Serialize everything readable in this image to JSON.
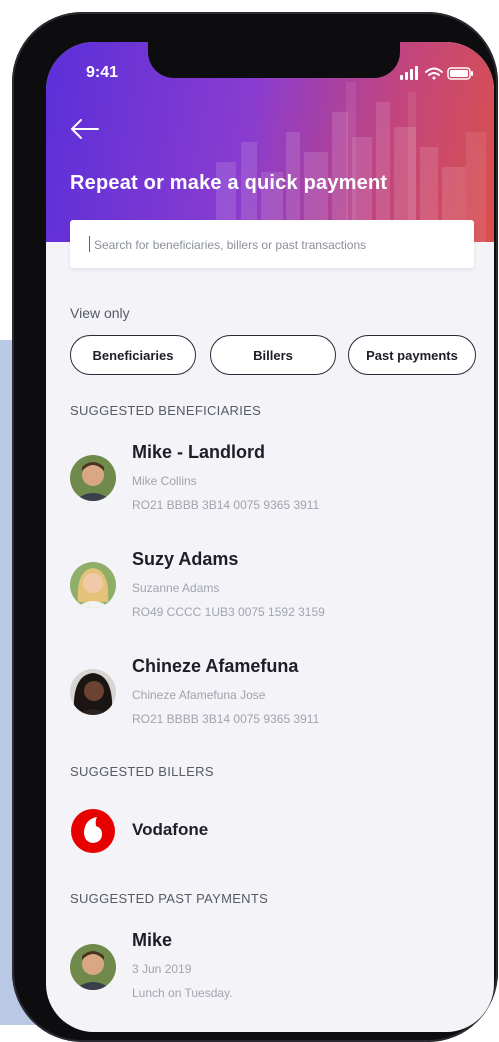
{
  "status_bar": {
    "time": "9:41"
  },
  "header": {
    "title": "Repeat or make a quick payment"
  },
  "search": {
    "placeholder": "Search for beneficiaries, billers or past transactions"
  },
  "filters": {
    "label": "View only",
    "chips": [
      "Beneficiaries",
      "Billers",
      "Past payments"
    ]
  },
  "sections": {
    "beneficiaries": "SUGGESTED BENEFICIARIES",
    "billers": "SUGGESTED BILLERS",
    "past_payments": "SUGGESTED PAST PAYMENTS"
  },
  "beneficiaries": [
    {
      "name": "Mike - Landlord",
      "full_name": "Mike Collins",
      "iban": "RO21 BBBB 3B14 0075 9365 3911"
    },
    {
      "name": "Suzy Adams",
      "full_name": "Suzanne Adams",
      "iban": "RO49 CCCC 1UB3 0075 1592 3159"
    },
    {
      "name": "Chineze Afamefuna",
      "full_name": "Chineze Afamefuna Jose",
      "iban": "RO21 BBBB 3B14 0075 9365 3911"
    }
  ],
  "billers": [
    {
      "name": "Vodafone"
    }
  ],
  "past_payments": [
    {
      "name": "Mike",
      "date": "3 Jun 2019",
      "note": "Lunch on Tuesday."
    }
  ],
  "colors": {
    "header_gradient_start": "#5b2fd9",
    "header_gradient_end": "#d9504d",
    "vodafone_red": "#e60000",
    "text_primary": "#1e1e28",
    "text_secondary": "#a0a4ad"
  }
}
